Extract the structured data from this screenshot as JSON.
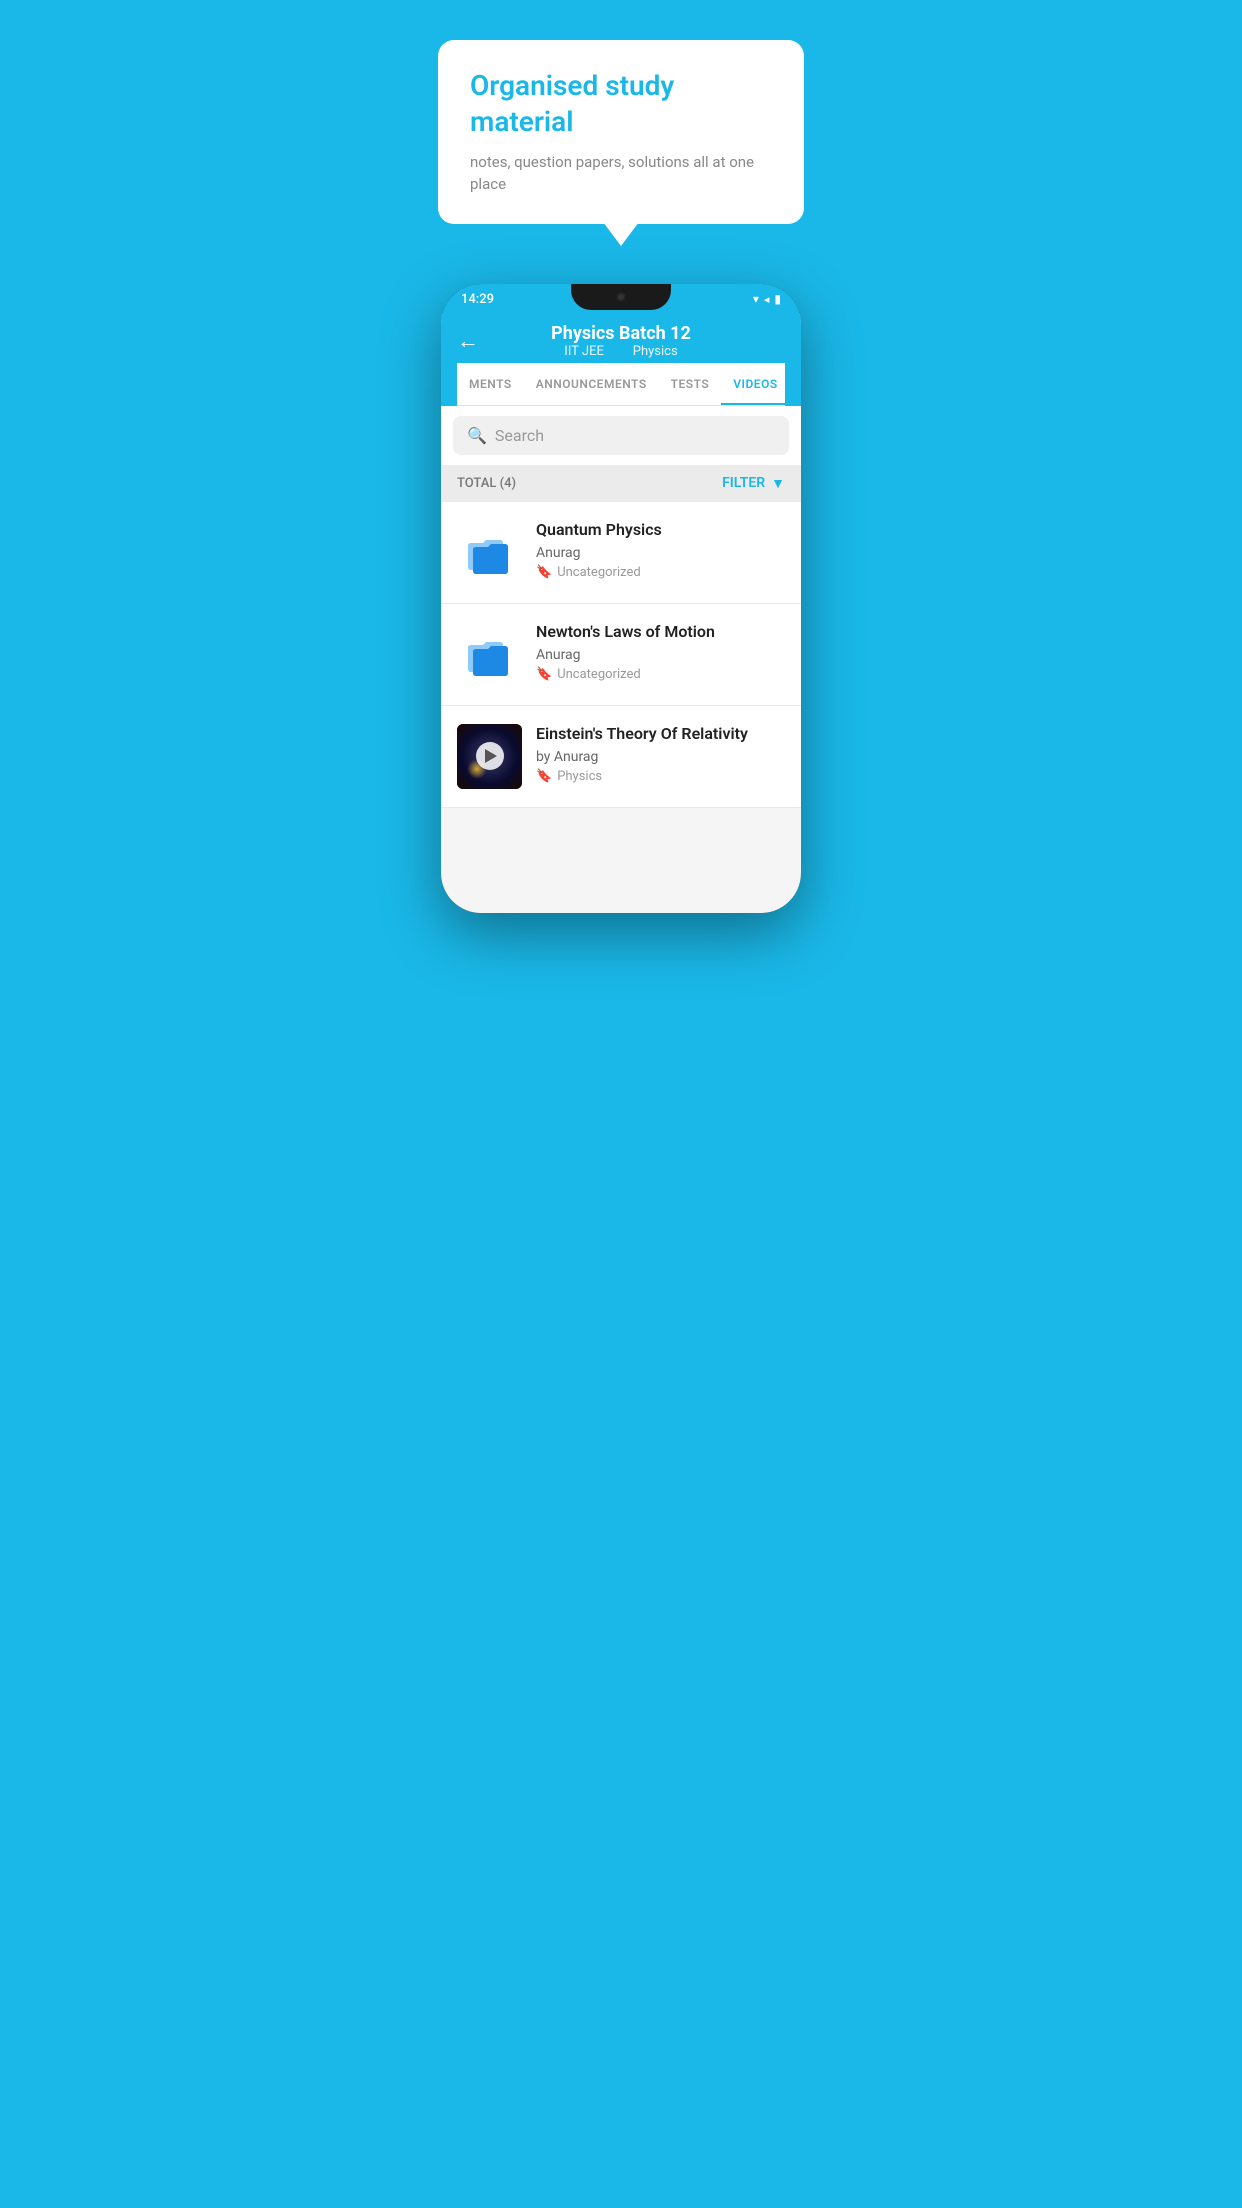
{
  "background_color": "#1ab8e8",
  "hero": {
    "title": "Organised study material",
    "subtitle": "notes, question papers, solutions all at one place"
  },
  "status_bar": {
    "time": "14:29",
    "wifi": "▾",
    "signal": "▲",
    "battery": "▮"
  },
  "app_header": {
    "title": "Physics Batch 12",
    "subtitle_part1": "IIT JEE",
    "subtitle_part2": "Physics",
    "back_label": "←"
  },
  "tabs": [
    {
      "id": "ments",
      "label": "MENTS",
      "active": false
    },
    {
      "id": "announcements",
      "label": "ANNOUNCEMENTS",
      "active": false
    },
    {
      "id": "tests",
      "label": "TESTS",
      "active": false
    },
    {
      "id": "videos",
      "label": "VIDEOS",
      "active": true
    }
  ],
  "search": {
    "placeholder": "Search"
  },
  "filter_bar": {
    "total_label": "TOTAL (4)",
    "filter_label": "FILTER"
  },
  "videos": [
    {
      "id": 1,
      "title": "Quantum Physics",
      "author": "Anurag",
      "tag": "Uncategorized",
      "type": "folder",
      "has_thumbnail": false
    },
    {
      "id": 2,
      "title": "Newton's Laws of Motion",
      "author": "Anurag",
      "tag": "Uncategorized",
      "type": "folder",
      "has_thumbnail": false
    },
    {
      "id": 3,
      "title": "Einstein's Theory Of Relativity",
      "author": "by Anurag",
      "tag": "Physics",
      "type": "video",
      "has_thumbnail": true
    }
  ]
}
